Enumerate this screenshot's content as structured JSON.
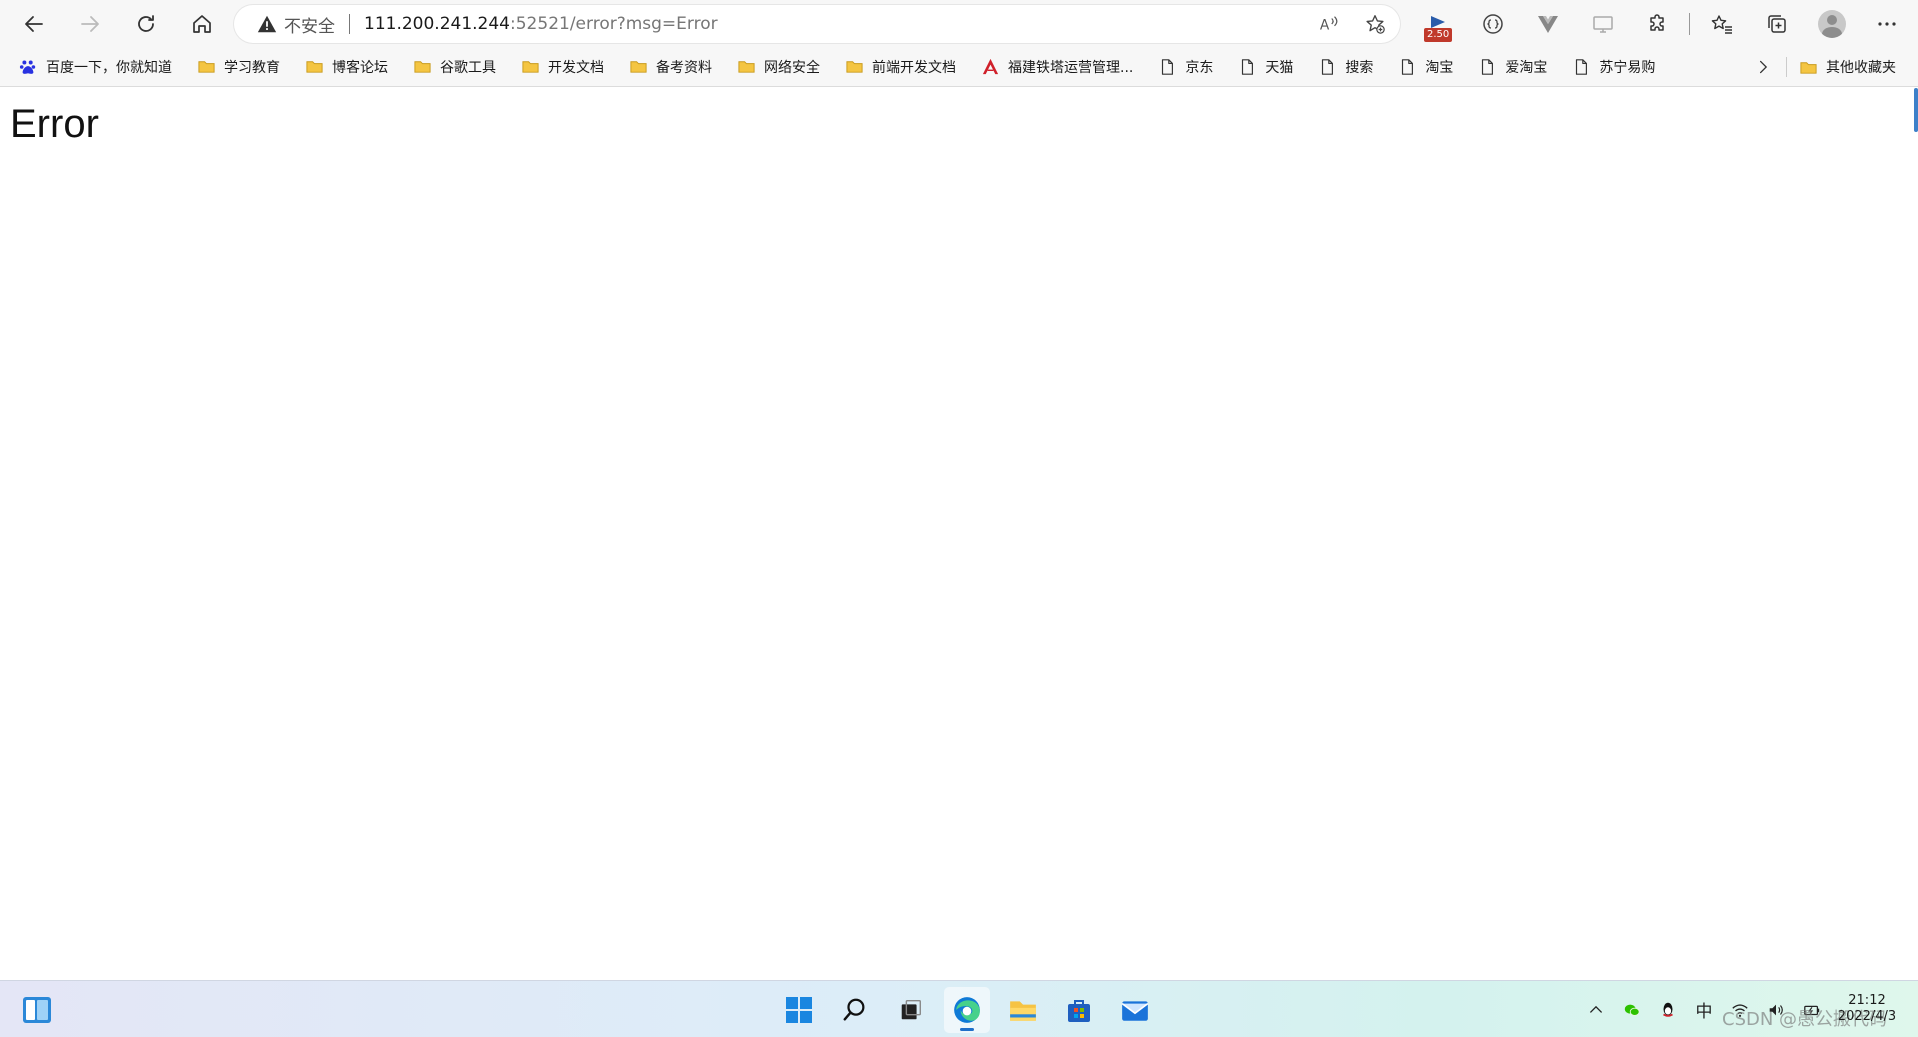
{
  "browser": {
    "security_label": "不安全",
    "url_host": "111.200.241.244",
    "url_rest": ":52521/error?msg=Error",
    "extension_badge": "2.50"
  },
  "bookmarks": {
    "items": [
      {
        "label": "百度一下，你就知道",
        "icon": "baidu-paw-icon"
      },
      {
        "label": "学习教育",
        "icon": "folder-icon"
      },
      {
        "label": "博客论坛",
        "icon": "folder-icon"
      },
      {
        "label": "谷歌工具",
        "icon": "folder-icon"
      },
      {
        "label": "开发文档",
        "icon": "folder-icon"
      },
      {
        "label": "备考资料",
        "icon": "folder-icon"
      },
      {
        "label": "网络安全",
        "icon": "folder-icon"
      },
      {
        "label": "前端开发文档",
        "icon": "folder-icon"
      },
      {
        "label": "福建铁塔运营管理...",
        "icon": "tower-logo-icon"
      },
      {
        "label": "京东",
        "icon": "page-icon"
      },
      {
        "label": "天猫",
        "icon": "page-icon"
      },
      {
        "label": "搜索",
        "icon": "page-icon"
      },
      {
        "label": "淘宝",
        "icon": "page-icon"
      },
      {
        "label": "爱淘宝",
        "icon": "page-icon"
      },
      {
        "label": "苏宁易购",
        "icon": "page-icon"
      }
    ],
    "other_label": "其他收藏夹"
  },
  "page": {
    "heading": "Error"
  },
  "taskbar": {
    "ime_label": "中",
    "clock_time": "21:12",
    "clock_date": "2022/4/3",
    "watermark": "CSDN @愚公搬代码"
  },
  "colors": {
    "folder": "#f4c542",
    "folder_edge": "#c99a1b",
    "accent_blue": "#1f6fc9",
    "tower_red": "#d0202a",
    "baidu_blue": "#2932e1"
  }
}
